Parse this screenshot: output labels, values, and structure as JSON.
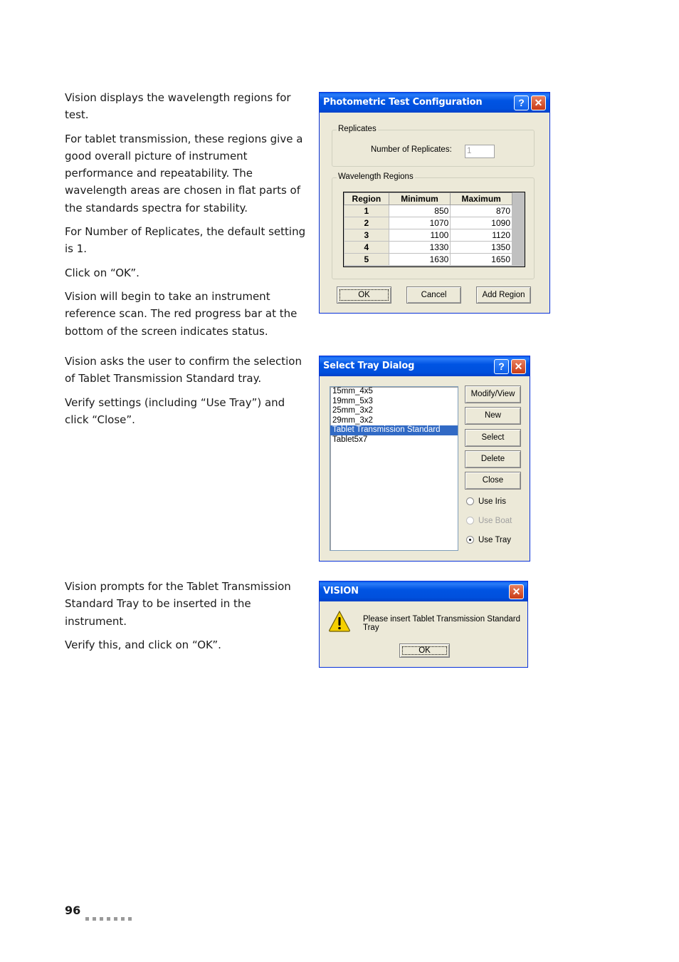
{
  "left_text": {
    "section1": [
      "Vision displays the wavelength regions for test.",
      "For tablet transmission, these regions give a good overall picture of instrument performance and repeatability. The wavelength areas are chosen in flat parts of the standards spectra for stability.",
      "For Number of Replicates, the default setting is 1.",
      "Click on “OK”.",
      "Vision will begin to take an instrument reference scan. The red progress bar at the bottom of the screen indicates status."
    ],
    "section2": [
      "Vision asks the user to confirm the selection of Tablet Transmission Standard tray.",
      "Verify settings (including “Use Tray”) and click “Close”."
    ],
    "section3": [
      "Vision prompts for the Tablet Transmission Standard Tray to be inserted in the instrument.",
      "Verify this, and click on “OK”."
    ]
  },
  "photometric_dialog": {
    "title": "Photometric Test Configuration",
    "help_icon": "?",
    "close_icon": "✕",
    "replicates_group": "Replicates",
    "replicates_label": "Number of Replicates:",
    "replicates_value": "1",
    "wavelength_group": "Wavelength Regions",
    "columns": [
      "Region",
      "Minimum",
      "Maximum"
    ],
    "rows": [
      {
        "region": "1",
        "min": "850",
        "max": "870"
      },
      {
        "region": "2",
        "min": "1070",
        "max": "1090"
      },
      {
        "region": "3",
        "min": "1100",
        "max": "1120"
      },
      {
        "region": "4",
        "min": "1330",
        "max": "1350"
      },
      {
        "region": "5",
        "min": "1630",
        "max": "1650"
      }
    ],
    "ok_label": "OK",
    "cancel_label": "Cancel",
    "add_region_label": "Add Region"
  },
  "tray_dialog": {
    "title": "Select Tray Dialog",
    "help_icon": "?",
    "close_icon": "✕",
    "items": [
      "15mm_4x5",
      "19mm_5x3",
      "25mm_3x2",
      "29mm_3x2",
      "Tablet Transmission Standard",
      "Tablet5x7"
    ],
    "selected_index": 4,
    "buttons": [
      "Modify/View",
      "New",
      "Select",
      "Delete",
      "Close"
    ],
    "radios": [
      {
        "label": "Use Iris",
        "checked": false,
        "disabled": false
      },
      {
        "label": "Use Boat",
        "checked": false,
        "disabled": true
      },
      {
        "label": "Use Tray",
        "checked": true,
        "disabled": false
      }
    ]
  },
  "vision_dialog": {
    "title": "VISION",
    "close_icon": "✕",
    "message": "Please insert Tablet Transmission Standard Tray",
    "ok_label": "OK"
  },
  "footer": {
    "page_number": "96"
  }
}
